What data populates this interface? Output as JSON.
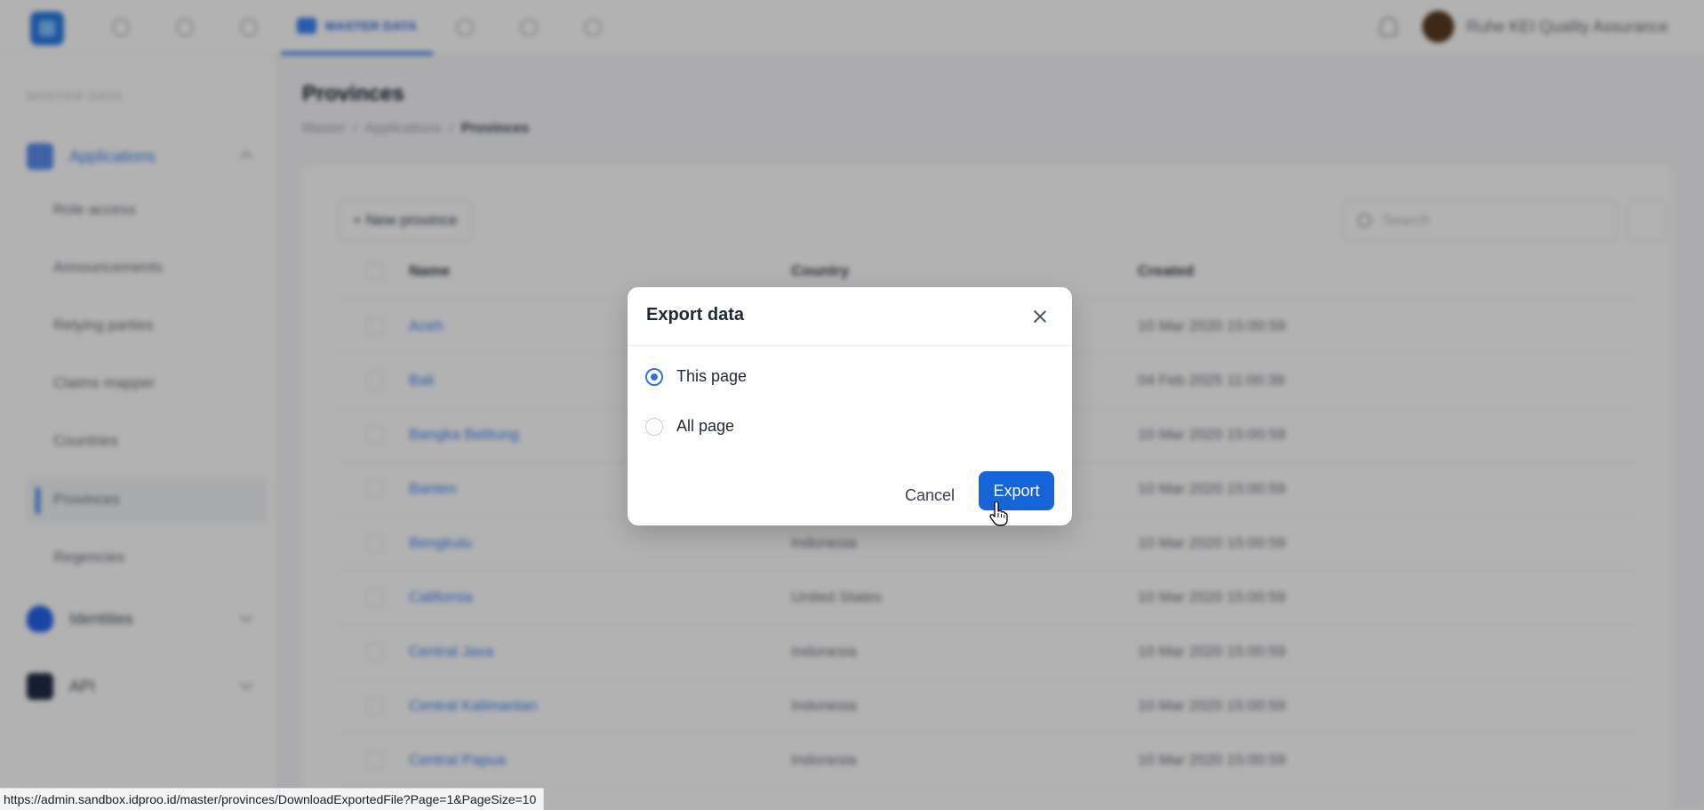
{
  "topbar": {
    "active_nav": "MASTER DATA",
    "user_name": "Ruhe KEI Quality Assurance"
  },
  "sidebar": {
    "heading": "MASTER DATA",
    "groups": [
      {
        "label": "Applications"
      },
      {
        "label": "Identities"
      },
      {
        "label": "API"
      }
    ],
    "items": [
      "Role access",
      "Announcements",
      "Relying parties",
      "Claims mapper",
      "Countries",
      "Provinces",
      "Regencies"
    ]
  },
  "main": {
    "title": "Provinces",
    "breadcrumb": {
      "c1": "Master",
      "c2": "Applications",
      "current": "Provinces"
    },
    "new_button": "+ New province",
    "search_placeholder": "Search",
    "columns": {
      "name": "Name",
      "country": "Country",
      "created": "Created"
    },
    "rows": [
      {
        "name": "Aceh",
        "country": "",
        "created": "10 Mar 2020 15:00:59"
      },
      {
        "name": "Bali",
        "country": "",
        "created": "04 Feb 2025 11:00:39"
      },
      {
        "name": "Bangka Belitung",
        "country": "",
        "created": "10 Mar 2020 15:00:59"
      },
      {
        "name": "Banten",
        "country": "",
        "created": "10 Mar 2020 15:00:59"
      },
      {
        "name": "Bengkulu",
        "country": "Indonesia",
        "created": "10 Mar 2020 15:00:59"
      },
      {
        "name": "California",
        "country": "United States",
        "created": "10 Mar 2020 15:00:59"
      },
      {
        "name": "Central Java",
        "country": "Indonesia",
        "created": "10 Mar 2020 15:00:59"
      },
      {
        "name": "Central Kalimantan",
        "country": "Indonesia",
        "created": "10 Mar 2020 15:00:59"
      },
      {
        "name": "Central Papua",
        "country": "Indonesia",
        "created": "10 Mar 2020 15:00:59"
      }
    ]
  },
  "modal": {
    "title": "Export data",
    "options": [
      {
        "label": "This page",
        "checked": true
      },
      {
        "label": "All page",
        "checked": false
      }
    ],
    "cancel_label": "Cancel",
    "export_label": "Export"
  },
  "status_url": "https://admin.sandbox.idproo.id/master/provinces/DownloadExportedFile?Page=1&PageSize=10",
  "colors": {
    "primary": "#1565d8",
    "radio_checked": "#3b6fd8",
    "overlay": "rgba(0,0,0,0.30)"
  }
}
